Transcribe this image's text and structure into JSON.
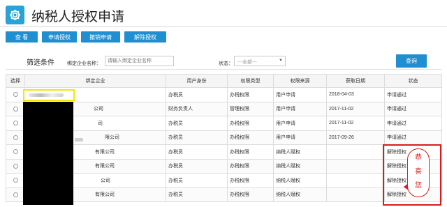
{
  "header": {
    "title": "纳税人授权申请",
    "icon": "gear-icon",
    "accent": "#29a3d6"
  },
  "toolbar": {
    "buttons": [
      "查 看",
      "申请授权",
      "撤销申请",
      "解除授权"
    ],
    "color": "#1f8fd1"
  },
  "filter": {
    "title": "筛选条件",
    "company_label": "绑定企业名称：",
    "company_placeholder": "请输入绑定企业名称",
    "status_label": "状态：",
    "status_value": "---全部---",
    "query_label": "查询"
  },
  "table": {
    "headers": [
      "选择",
      "绑定企业",
      "用户身份",
      "权限类型",
      "权限来源",
      "获取日期",
      "状态"
    ],
    "rows": [
      {
        "company": "",
        "role": "办税员",
        "perm": "办税权限",
        "source": "用户申请",
        "date": "2018-04-03",
        "status": "申请通过"
      },
      {
        "company": "公司",
        "role": "财务负责人",
        "perm": "管理权限",
        "source": "用户申请",
        "date": "2017-11-02",
        "status": "申请通过"
      },
      {
        "company": "司",
        "role": "办税员",
        "perm": "办税权限",
        "source": "用户申请",
        "date": "2017-11-02",
        "status": "申请通过"
      },
      {
        "company": "限公司",
        "role": "办税员",
        "perm": "办税权限",
        "source": "用户申请",
        "date": "2017-09-26",
        "status": "申请通过"
      },
      {
        "company": "有限公司",
        "role": "办税员",
        "perm": "办税权限",
        "source": "纳税人赋权",
        "date": "",
        "status": "解除授权"
      },
      {
        "company": "有限公司",
        "role": "办税员",
        "perm": "办税权限",
        "source": "纳税人赋权",
        "date": "",
        "status": "解除授权"
      },
      {
        "company": "公司",
        "role": "办税员",
        "perm": "办税权限",
        "source": "纳税人赋权",
        "date": "",
        "status": "解除授权"
      },
      {
        "company": "有限公司",
        "role": "办税员",
        "perm": "办税权限",
        "source": "纳税人赋权",
        "date": "",
        "status": "解除授权"
      }
    ]
  },
  "annotation": {
    "text": [
      "恭",
      "喜",
      "您"
    ],
    "color": "#d91b1b"
  }
}
